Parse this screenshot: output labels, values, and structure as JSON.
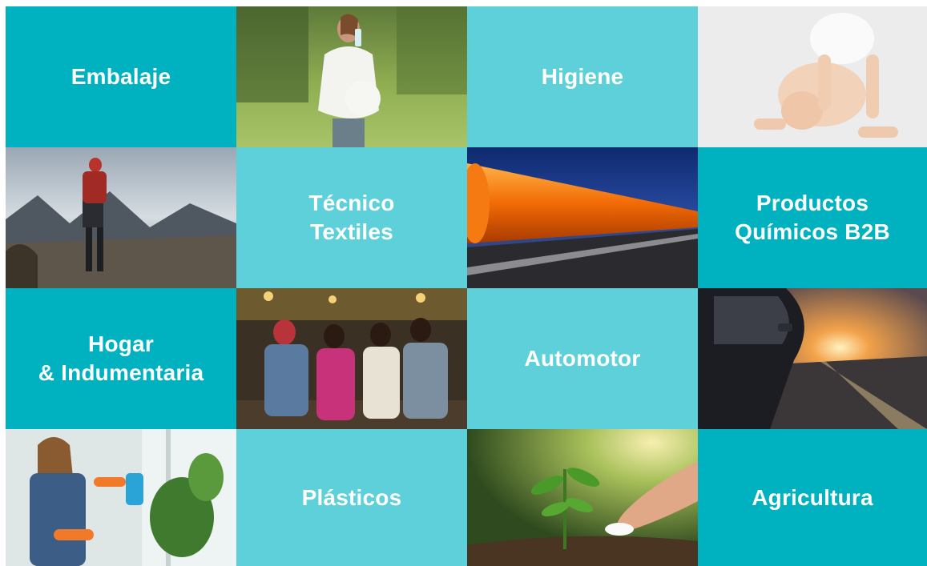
{
  "tiles": [
    {
      "label": "Embalaje",
      "icon": "packaging-category"
    },
    {
      "label": "Higiene",
      "icon": "hygiene-category"
    },
    {
      "label": "Técnico\nTextiles",
      "icon": "technical-textiles-category"
    },
    {
      "label": "Productos\nQuímicos B2B",
      "icon": "b2b-chemicals-category"
    },
    {
      "label": "Hogar\n& Indumentaria",
      "icon": "home-apparel-category"
    },
    {
      "label": "Automotor",
      "icon": "automotive-category"
    },
    {
      "label": "Plásticos",
      "icon": "plastics-category"
    },
    {
      "label": "Agricultura",
      "icon": "agriculture-category"
    }
  ],
  "photos": [
    {
      "subject": "pregnant-woman-drinking-water"
    },
    {
      "subject": "baby-diaper"
    },
    {
      "subject": "hiker-mountains"
    },
    {
      "subject": "orange-tanker-train"
    },
    {
      "subject": "group-of-friends"
    },
    {
      "subject": "car-sunset-road"
    },
    {
      "subject": "woman-watering-plants"
    },
    {
      "subject": "seedling-hand-fertilizer"
    }
  ],
  "colors": {
    "tile_dark": "#00b2c0",
    "tile_light": "#5ed0da",
    "text": "#ffffff"
  }
}
